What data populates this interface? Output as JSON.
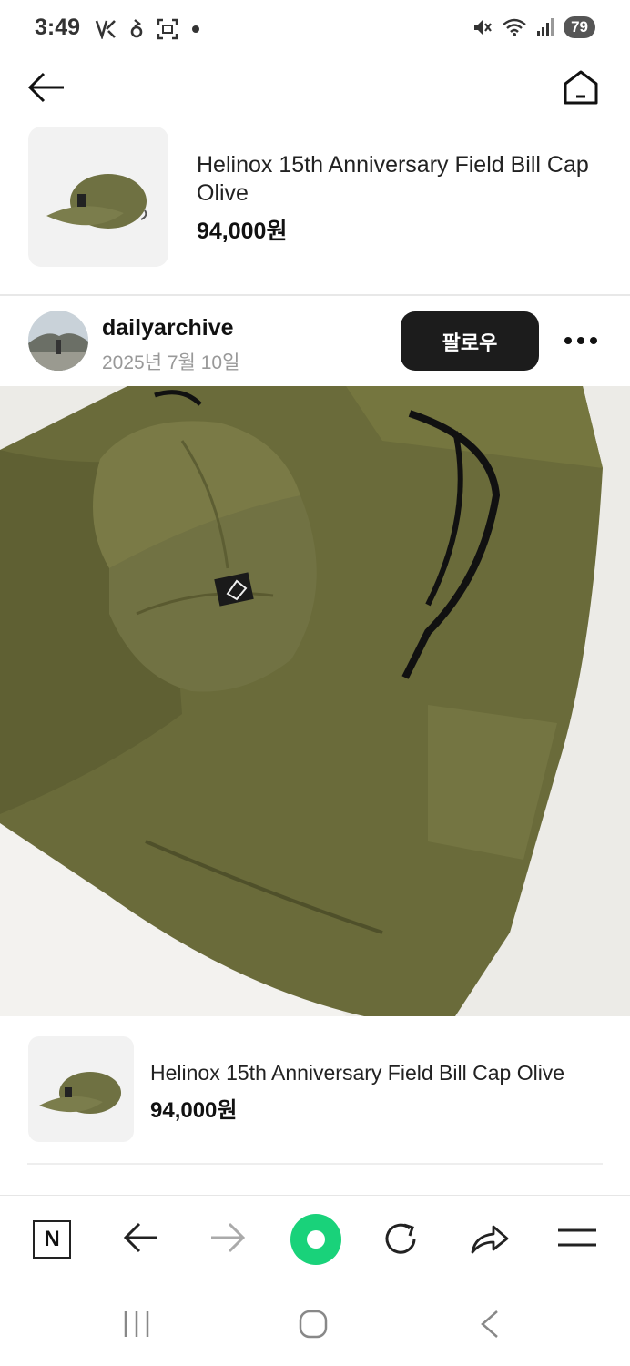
{
  "status_bar": {
    "time": "3:49",
    "battery": "79"
  },
  "header": {
    "back_icon": "arrow-left-icon",
    "home_icon": "home-icon"
  },
  "top_product": {
    "title": "Helinox 15th Anniversary Field Bill Cap Olive",
    "price": "94,000원"
  },
  "post": {
    "username": "dailyarchive",
    "date": "2025년 7월 10일",
    "follow_label": "팔로우"
  },
  "bottom_product": {
    "title": "Helinox 15th Anniversary Field Bill Cap Olive",
    "price": "94,000원"
  },
  "browser_toolbar": {
    "items": [
      "naver-n-icon",
      "back-arrow-icon",
      "forward-arrow-icon",
      "green-dot-button",
      "refresh-icon",
      "share-icon",
      "menu-icon"
    ],
    "n_label": "N"
  },
  "colors": {
    "accent_green": "#19d27a",
    "olive": "#6f7142",
    "follow_bg": "#1c1c1c"
  }
}
